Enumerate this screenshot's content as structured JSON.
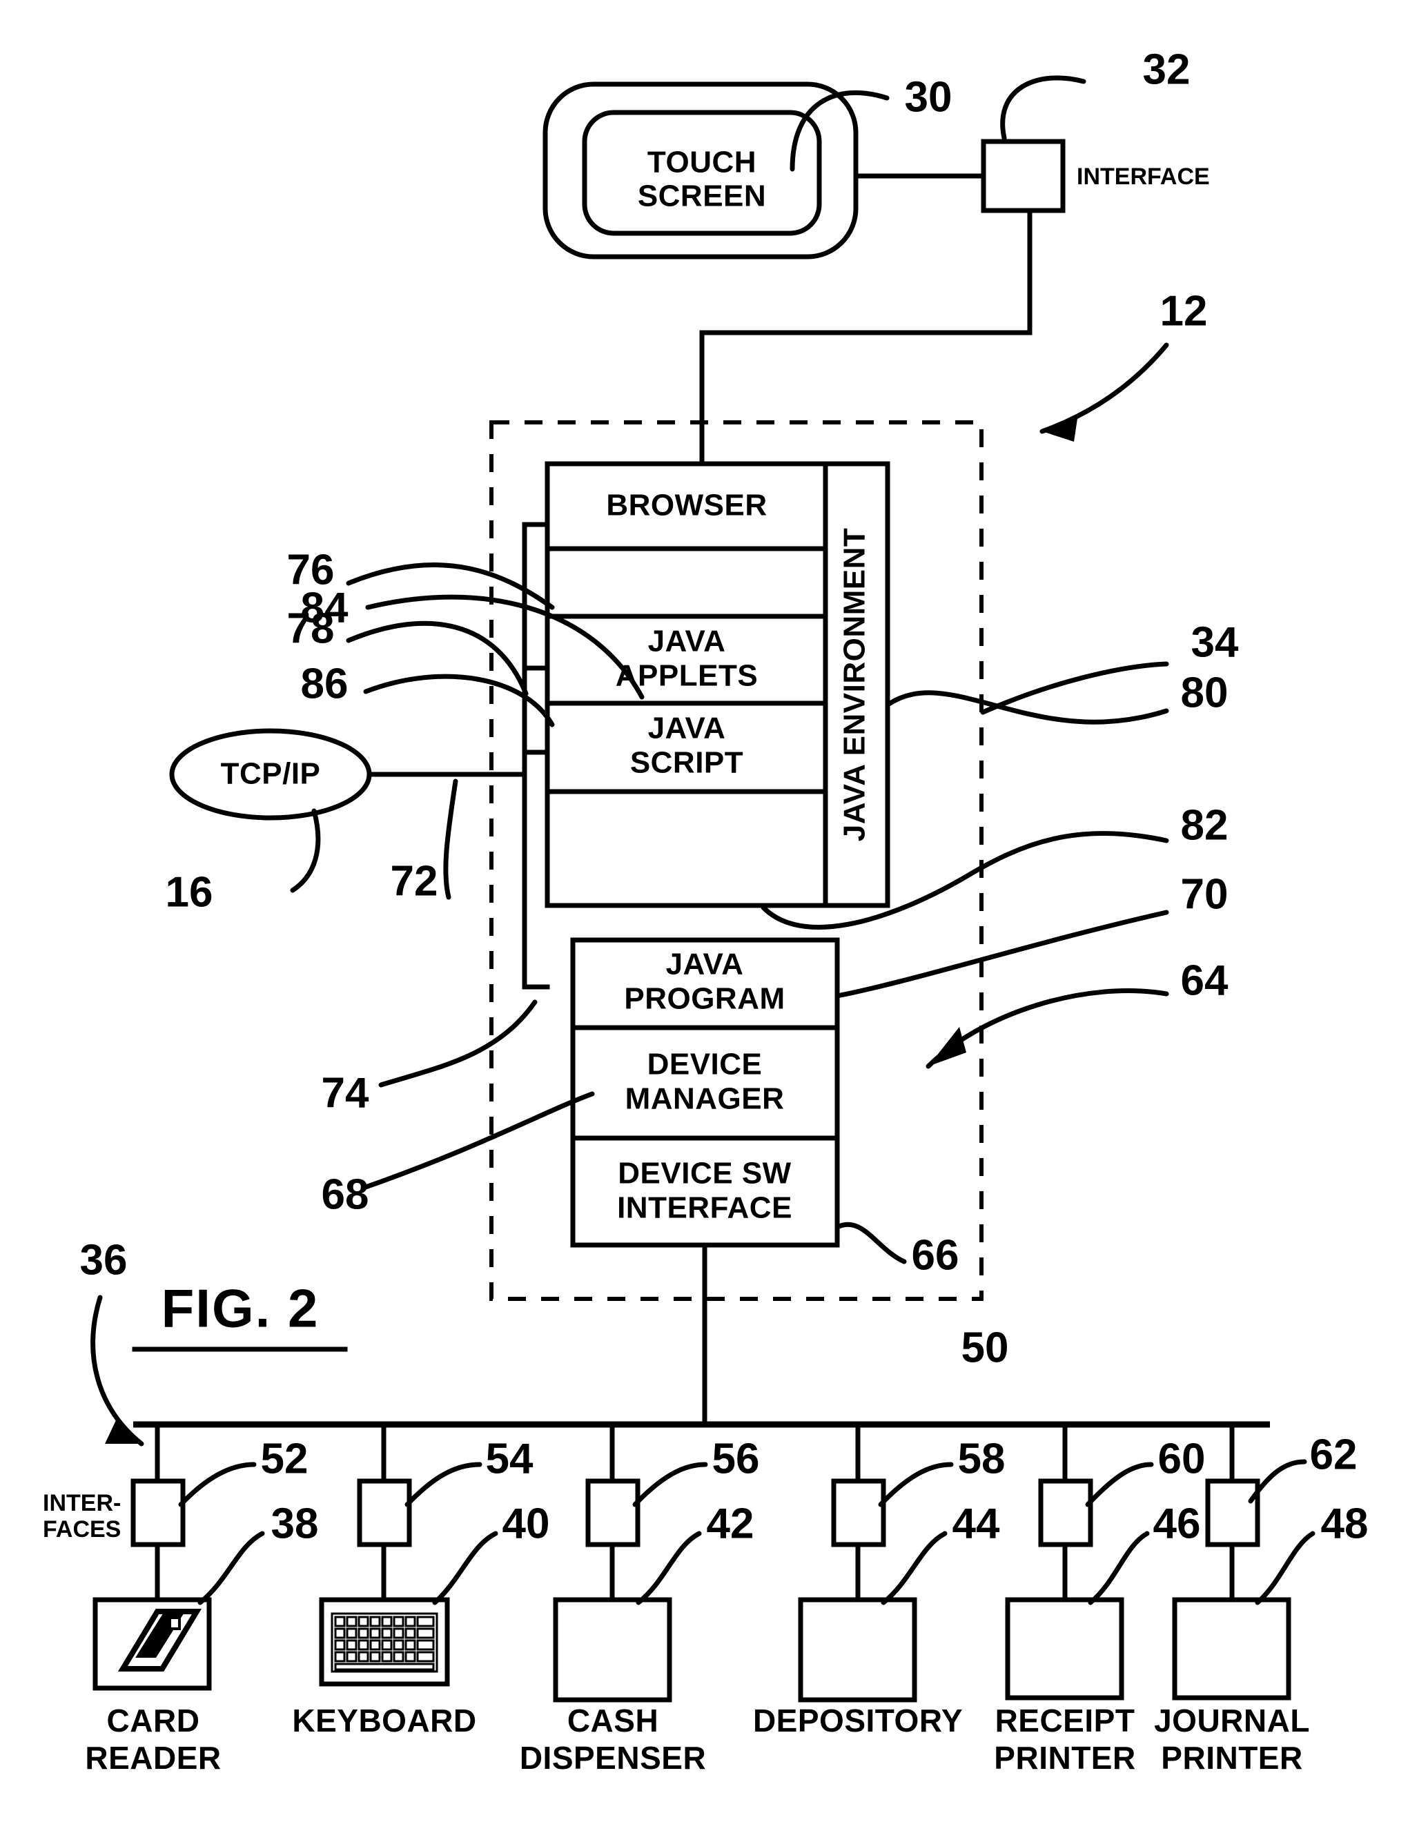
{
  "figure": {
    "title": "FIG.  2",
    "caption_underline": true
  },
  "nodes": {
    "touch_screen": {
      "label_line1": "TOUCH",
      "label_line2": "SCREEN",
      "ref": "30"
    },
    "interface_top": {
      "label": "INTERFACE",
      "ref": "32"
    },
    "browser": {
      "label": "BROWSER"
    },
    "java_environment": {
      "label": "JAVA ENVIRONMENT"
    },
    "java_applets": {
      "label_line1": "JAVA",
      "label_line2": "APPLETS"
    },
    "java_script": {
      "label_line1": "JAVA",
      "label_line2": "SCRIPT"
    },
    "java_program": {
      "label_line1": "JAVA",
      "label_line2": "PROGRAM"
    },
    "device_manager": {
      "label_line1": "DEVICE",
      "label_line2": "MANAGER"
    },
    "device_sw_interface": {
      "label_line1": "DEVICE SW",
      "label_line2": "INTERFACE"
    },
    "tcpip": {
      "label": "TCP/IP",
      "ref": "16"
    },
    "interfaces_group": {
      "label_line1": "INTER-",
      "label_line2": "FACES",
      "ref": "36"
    }
  },
  "reference_numerals": {
    "terminal": "12",
    "network": "16",
    "touch_screen": "30",
    "touch_interface": "32",
    "java_env_block": "34",
    "interfaces_label": "36",
    "card_reader": "38",
    "keyboard": "40",
    "cash_dispenser": "42",
    "depository": "44",
    "receipt_printer": "46",
    "journal_printer": "48",
    "bus": "50",
    "iface_card_reader": "52",
    "iface_keyboard": "54",
    "iface_cash_dispenser": "56",
    "iface_depository": "58",
    "iface_receipt_printer": "60",
    "iface_journal_printer": "62",
    "software_stack": "64",
    "device_sw_interface": "66",
    "device_manager": "68",
    "java_program": "70",
    "tcpip_link": "72",
    "java_program_link": "74",
    "browser_link_a": "76",
    "browser_link_b": "78",
    "java_environment": "80",
    "java_program_ref": "82",
    "java_applets_link": "84",
    "java_script_link": "86"
  },
  "devices": [
    {
      "name": "CARD",
      "name2": "READER",
      "device_ref": "38",
      "interface_ref": "52",
      "icon": "card-icon"
    },
    {
      "name": "KEYBOARD",
      "name2": "",
      "device_ref": "40",
      "interface_ref": "54",
      "icon": "keyboard-icon"
    },
    {
      "name": "CASH",
      "name2": "DISPENSER",
      "device_ref": "42",
      "interface_ref": "56",
      "icon": "blank-icon"
    },
    {
      "name": "DEPOSITORY",
      "name2": "",
      "device_ref": "44",
      "interface_ref": "58",
      "icon": "blank-icon"
    },
    {
      "name": "RECEIPT",
      "name2": "PRINTER",
      "device_ref": "46",
      "interface_ref": "60",
      "icon": "blank-icon"
    },
    {
      "name": "JOURNAL",
      "name2": "PRINTER",
      "device_ref": "48",
      "interface_ref": "62",
      "icon": "blank-icon"
    }
  ],
  "colors": {
    "ink": "#000000",
    "paper": "#ffffff"
  }
}
